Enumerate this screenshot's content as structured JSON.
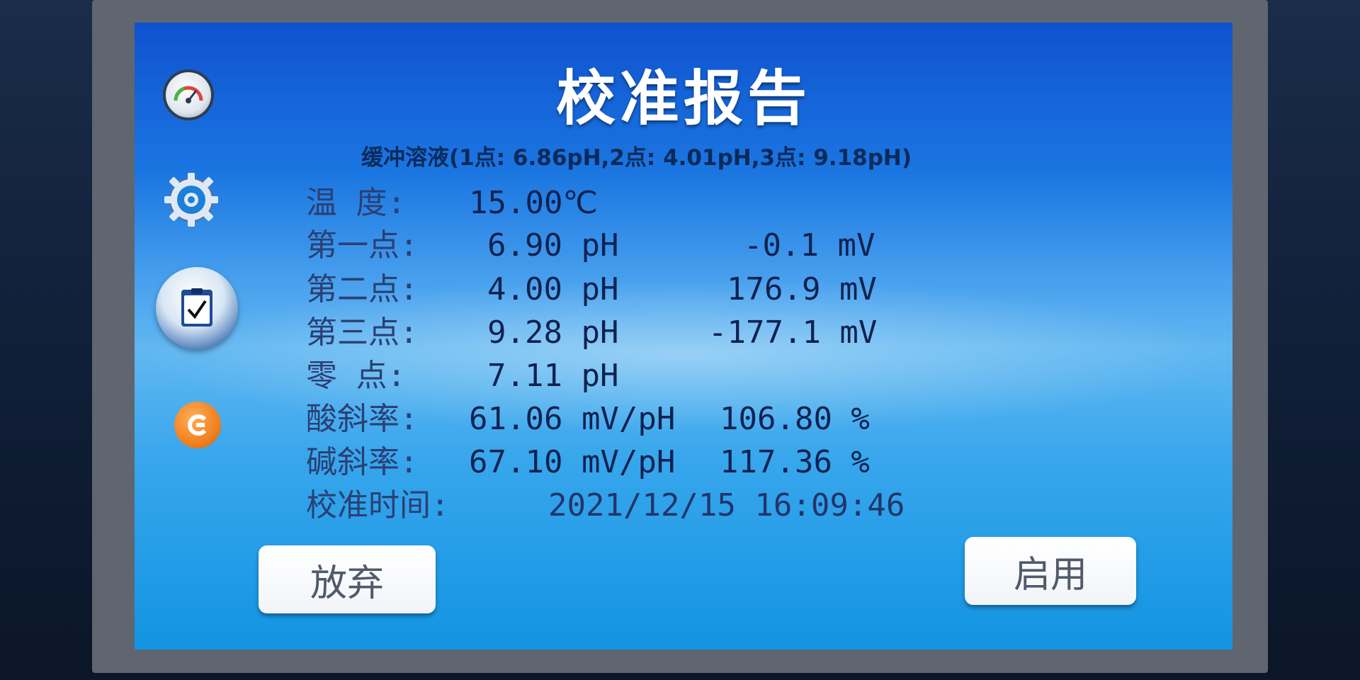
{
  "title": "校准报告",
  "buffer_line": "缓冲溶液(1点:  6.86pH,2点:  4.01pH,3点:  9.18pH)",
  "rows": {
    "temperature": {
      "label": "温  度:",
      "value": "15.00℃"
    },
    "point1": {
      "label": "第一点:",
      "ph": "6.90 pH",
      "mv": "-0.1 mV"
    },
    "point2": {
      "label": "第二点:",
      "ph": "4.00 pH",
      "mv": "176.9 mV"
    },
    "point3": {
      "label": "第三点:",
      "ph": "9.28 pH",
      "mv": "-177.1 mV"
    },
    "zero": {
      "label": "零  点:",
      "ph": "7.11 pH"
    },
    "acid_slope": {
      "label": "酸斜率:",
      "value": "61.06 mV/pH",
      "percent": "106.80 %"
    },
    "base_slope": {
      "label": "碱斜率:",
      "value": "67.10 mV/pH",
      "percent": "117.36 %"
    },
    "cal_time": {
      "label": "校准时间:",
      "value": "2021/12/15 16:09:46"
    }
  },
  "buttons": {
    "discard": "放弃",
    "enable": "启用"
  },
  "sidebar_icons": [
    "gauge-icon",
    "gear-icon",
    "report-check-icon",
    "exit-icon"
  ],
  "colors": {
    "screen_blue": "#1b76e1",
    "title_white": "#ffffff",
    "text_dark": "#0f2250",
    "exit_orange": "#f07e1c"
  }
}
